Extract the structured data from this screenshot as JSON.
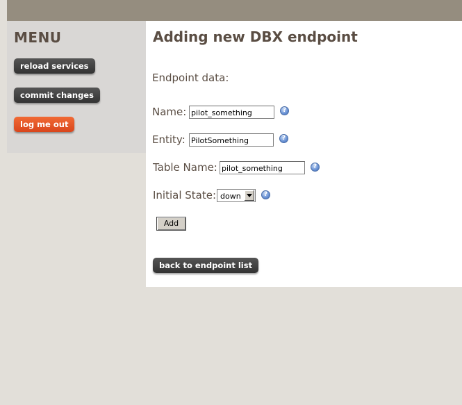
{
  "menu": {
    "title": "MENU",
    "items": [
      {
        "label": "reload services"
      },
      {
        "label": "commit changes"
      },
      {
        "label": "log me out"
      }
    ]
  },
  "page": {
    "title": "Adding new DBX endpoint",
    "section_label": "Endpoint data:"
  },
  "form": {
    "name": {
      "label": "Name:",
      "value": "pilot_something"
    },
    "entity": {
      "label": "Entity:",
      "value": "PilotSomething"
    },
    "table_name": {
      "label": "Table Name:",
      "value": "pilot_something"
    },
    "initial_state": {
      "label": "Initial State:",
      "value": "down"
    },
    "help_glyph": "?",
    "add_label": "Add"
  },
  "actions": {
    "back_label": "back to endpoint list"
  },
  "colors": {
    "topbar": "#958d7f",
    "sidebar": "#d9d7d5",
    "page_background": "#e2dfd9",
    "heading": "#5a4d43",
    "dark_button": "#444444",
    "logout_button": "#e65a2a"
  }
}
